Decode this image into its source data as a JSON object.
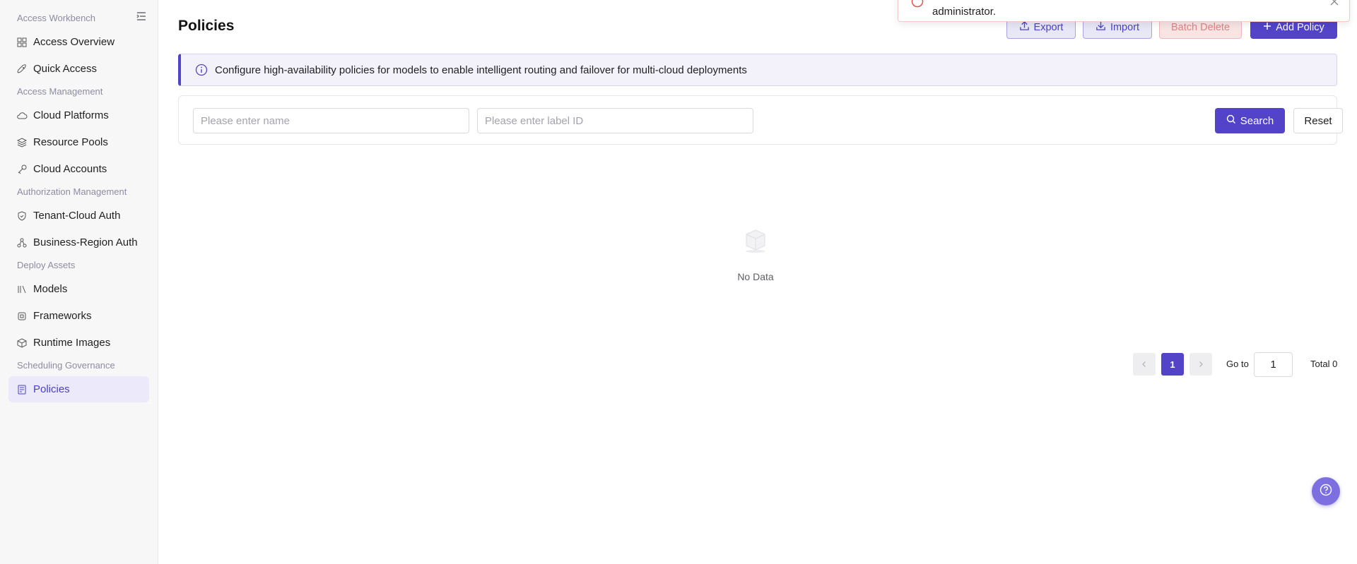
{
  "sidebar": {
    "groups": [
      {
        "title": "Access Workbench",
        "items": [
          {
            "label": "Access Overview",
            "icon": "dashboard-icon"
          },
          {
            "label": "Quick Access",
            "icon": "rocket-icon"
          }
        ]
      },
      {
        "title": "Access Management",
        "items": [
          {
            "label": "Cloud Platforms",
            "icon": "cloud-icon"
          },
          {
            "label": "Resource Pools",
            "icon": "layers-icon"
          },
          {
            "label": "Cloud Accounts",
            "icon": "key-icon"
          }
        ]
      },
      {
        "title": "Authorization Management",
        "items": [
          {
            "label": "Tenant-Cloud Auth",
            "icon": "shield-icon"
          },
          {
            "label": "Business-Region Auth",
            "icon": "nodes-icon"
          }
        ]
      },
      {
        "title": "Deploy Assets",
        "items": [
          {
            "label": "Models",
            "icon": "library-icon"
          },
          {
            "label": "Frameworks",
            "icon": "chip-icon"
          },
          {
            "label": "Runtime Images",
            "icon": "box-icon"
          }
        ]
      },
      {
        "title": "Scheduling Governance",
        "items": [
          {
            "label": "Policies",
            "icon": "policy-icon",
            "active": true
          }
        ]
      }
    ]
  },
  "main": {
    "title": "Policies",
    "toolbar": {
      "export": "Export",
      "import": "Import",
      "batch_delete": "Batch Delete",
      "add_policy": "Add Policy"
    },
    "info": "Configure high-availability policies for models to enable intelligent routing and failover for multi-cloud deployments",
    "filters": {
      "name_placeholder": "Please enter name",
      "label_placeholder": "Please enter label ID",
      "search": "Search",
      "reset": "Reset"
    },
    "empty_text": "No Data",
    "pagination": {
      "current_page": "1",
      "goto_label": "Go to",
      "goto_value": "1",
      "total": "Total 0"
    }
  },
  "toast": {
    "message": "administrator.",
    "type": "error"
  },
  "colors": {
    "accent": "#5243c9",
    "sidebar_active_bg": "#ebe9fa",
    "danger": "#d98585"
  }
}
